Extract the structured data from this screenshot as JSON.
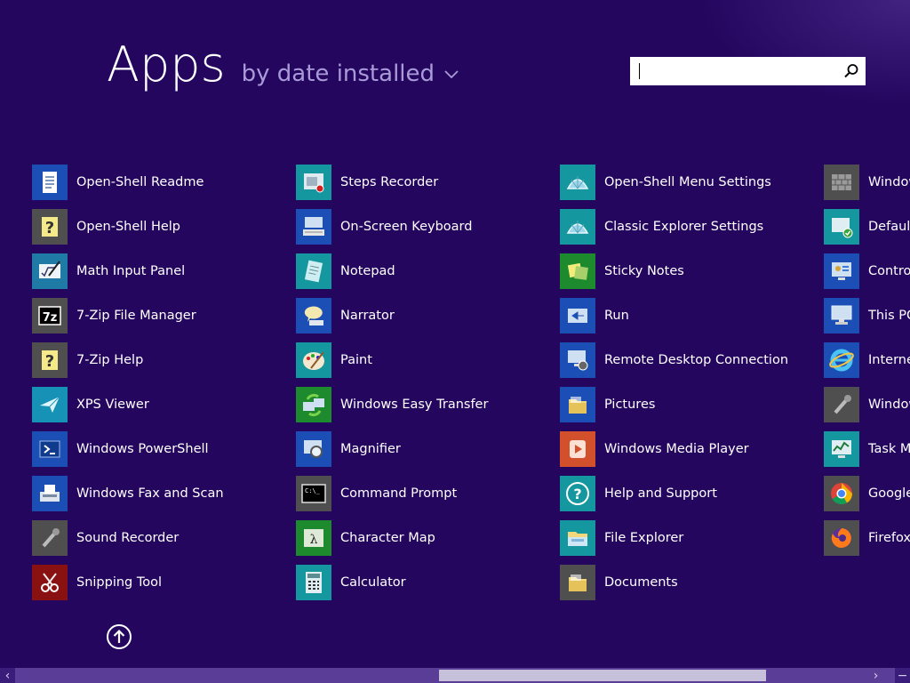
{
  "header": {
    "title": "Apps",
    "sort_label": "by date installed"
  },
  "search": {
    "value": "",
    "placeholder": ""
  },
  "columns": [
    [
      {
        "label": "Open-Shell Readme",
        "icon": "document-icon",
        "tile": "#1c4fb5"
      },
      {
        "label": "Open-Shell Help",
        "icon": "help-file-icon",
        "tile": "#4f4f4f"
      },
      {
        "label": "Math Input Panel",
        "icon": "math-input-icon",
        "tile": "#1f7aa6"
      },
      {
        "label": "7-Zip File Manager",
        "icon": "7zip-icon",
        "tile": "#4f4f4f"
      },
      {
        "label": "7-Zip Help",
        "icon": "help-file-icon",
        "tile": "#4f4f4f"
      },
      {
        "label": "XPS Viewer",
        "icon": "xps-icon",
        "tile": "#1592b5"
      },
      {
        "label": "Windows PowerShell",
        "icon": "powershell-icon",
        "tile": "#1c4fb5"
      },
      {
        "label": "Windows Fax and Scan",
        "icon": "fax-icon",
        "tile": "#1c4fb5"
      },
      {
        "label": "Sound Recorder",
        "icon": "microphone-icon",
        "tile": "#4f4f4f"
      },
      {
        "label": "Snipping Tool",
        "icon": "scissors-icon",
        "tile": "#8a1111"
      }
    ],
    [
      {
        "label": "Steps Recorder",
        "icon": "steps-recorder-icon",
        "tile": "#1597a0"
      },
      {
        "label": "On-Screen Keyboard",
        "icon": "keyboard-icon",
        "tile": "#1c4fb5"
      },
      {
        "label": "Notepad",
        "icon": "notepad-icon",
        "tile": "#1597a0"
      },
      {
        "label": "Narrator",
        "icon": "narrator-icon",
        "tile": "#1c4fb5"
      },
      {
        "label": "Paint",
        "icon": "palette-icon",
        "tile": "#1597a0"
      },
      {
        "label": "Windows Easy Transfer",
        "icon": "transfer-icon",
        "tile": "#1d8a2d"
      },
      {
        "label": "Magnifier",
        "icon": "magnifier-icon",
        "tile": "#1c4fb5"
      },
      {
        "label": "Command Prompt",
        "icon": "terminal-icon",
        "tile": "#4f4f4f"
      },
      {
        "label": "Character Map",
        "icon": "character-map-icon",
        "tile": "#1d8a2d"
      },
      {
        "label": "Calculator",
        "icon": "calculator-icon",
        "tile": "#1597a0"
      }
    ],
    [
      {
        "label": "Open-Shell Menu Settings",
        "icon": "shell-icon",
        "tile": "#1597a0"
      },
      {
        "label": "Classic Explorer Settings",
        "icon": "shell-icon",
        "tile": "#1597a0"
      },
      {
        "label": "Sticky Notes",
        "icon": "sticky-notes-icon",
        "tile": "#1d8a2d"
      },
      {
        "label": "Run",
        "icon": "run-icon",
        "tile": "#1c4fb5"
      },
      {
        "label": "Remote Desktop Connection",
        "icon": "remote-desktop-icon",
        "tile": "#1c4fb5"
      },
      {
        "label": "Pictures",
        "icon": "folder-icon",
        "tile": "#1c4fb5"
      },
      {
        "label": "Windows Media Player",
        "icon": "media-player-icon",
        "tile": "#d2502b"
      },
      {
        "label": "Help and Support",
        "icon": "question-icon",
        "tile": "#1597a0"
      },
      {
        "label": "File Explorer",
        "icon": "file-explorer-icon",
        "tile": "#1597a0"
      },
      {
        "label": "Documents",
        "icon": "folder-icon",
        "tile": "#4f4f4f"
      }
    ],
    [
      {
        "label": "Window",
        "icon": "firewall-icon",
        "tile": "#4f4f4f"
      },
      {
        "label": "Default",
        "icon": "default-programs-icon",
        "tile": "#1597a0"
      },
      {
        "label": "Control",
        "icon": "control-panel-icon",
        "tile": "#1c4fb5"
      },
      {
        "label": "This PC",
        "icon": "computer-icon",
        "tile": "#1c4fb5"
      },
      {
        "label": "Internet",
        "icon": "ie-icon",
        "tile": "#1c4fb5"
      },
      {
        "label": "Window",
        "icon": "microphone-icon",
        "tile": "#4f4f4f"
      },
      {
        "label": "Task Ma",
        "icon": "task-manager-icon",
        "tile": "#1597a0"
      },
      {
        "label": "Google",
        "icon": "chrome-icon",
        "tile": "#4f4f4f"
      },
      {
        "label": "Firefox",
        "icon": "firefox-icon",
        "tile": "#4f4f4f"
      }
    ]
  ],
  "colors": {
    "background": "#24065f",
    "sort_text": "#a99bd8",
    "scrollbar_track": "#5a3d96",
    "scrollbar_thumb": "#c7c0da"
  },
  "scroll_up_icon": "arrow-up-circle-icon"
}
